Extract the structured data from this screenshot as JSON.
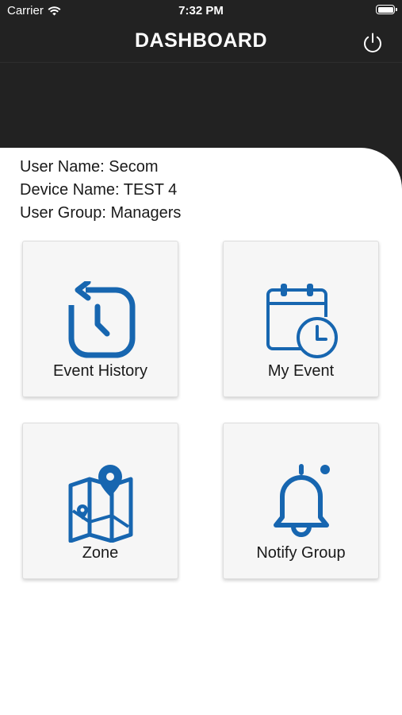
{
  "status_bar": {
    "carrier": "Carrier",
    "time": "7:32 PM",
    "wifi_icon": "wifi-icon",
    "battery_icon": "battery-icon"
  },
  "nav": {
    "title": "DASHBOARD",
    "power_icon": "power-icon"
  },
  "user": {
    "name_line": "User Name: Secom",
    "device_line": "Device Name: TEST 4",
    "group_line": "User Group: Managers"
  },
  "tiles": [
    {
      "label": "Event History",
      "icon": "history-icon"
    },
    {
      "label": "My Event",
      "icon": "calendar-clock-icon"
    },
    {
      "label": "Zone",
      "icon": "map-pin-icon"
    },
    {
      "label": "Notify Group",
      "icon": "bell-icon"
    }
  ],
  "colors": {
    "header_bg": "#222222",
    "accent_blue": "#1766b0",
    "tile_bg": "#f6f6f6"
  }
}
